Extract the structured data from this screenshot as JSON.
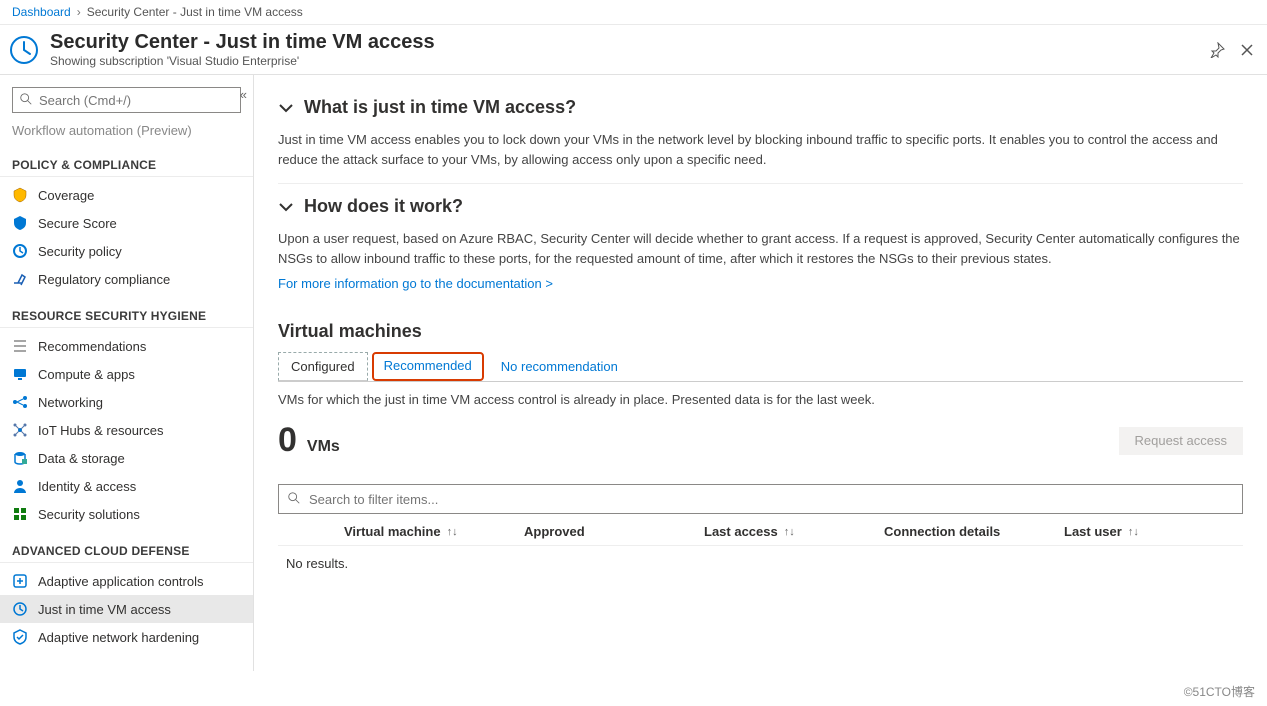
{
  "breadcrumb": {
    "root": "Dashboard",
    "current": "Security Center - Just in time VM access"
  },
  "header": {
    "title": "Security Center - Just in time VM access",
    "subtitle": "Showing subscription 'Visual Studio Enterprise'"
  },
  "search": {
    "placeholder": "Search (Cmd+/)"
  },
  "sidebar": {
    "cut_item": "Workflow automation (Preview)",
    "groups": [
      {
        "title": "POLICY & COMPLIANCE",
        "items": [
          {
            "label": "Coverage",
            "icon": "coverage"
          },
          {
            "label": "Secure Score",
            "icon": "shield"
          },
          {
            "label": "Security policy",
            "icon": "policy"
          },
          {
            "label": "Regulatory compliance",
            "icon": "gavel"
          }
        ]
      },
      {
        "title": "RESOURCE SECURITY HYGIENE",
        "items": [
          {
            "label": "Recommendations",
            "icon": "list"
          },
          {
            "label": "Compute & apps",
            "icon": "compute"
          },
          {
            "label": "Networking",
            "icon": "network"
          },
          {
            "label": "IoT Hubs & resources",
            "icon": "iot"
          },
          {
            "label": "Data & storage",
            "icon": "data"
          },
          {
            "label": "Identity & access",
            "icon": "identity"
          },
          {
            "label": "Security solutions",
            "icon": "grid"
          }
        ]
      },
      {
        "title": "ADVANCED CLOUD DEFENSE",
        "items": [
          {
            "label": "Adaptive application controls",
            "icon": "app-controls"
          },
          {
            "label": "Just in time VM access",
            "icon": "clock",
            "selected": true
          },
          {
            "label": "Adaptive network hardening",
            "icon": "net-hardening"
          }
        ]
      }
    ]
  },
  "content": {
    "exp1_title": "What is just in time VM access?",
    "exp1_body": "Just in time VM access enables you to lock down your VMs in the network level by blocking inbound traffic to specific ports. It enables you to control the access and reduce the attack surface to your VMs, by allowing access only upon a specific need.",
    "exp2_title": "How does it work?",
    "exp2_body": "Upon a user request, based on Azure RBAC, Security Center will decide whether to grant access. If a request is approved, Security Center automatically configures the NSGs to allow inbound traffic to these ports, for the requested amount of time, after which it restores the NSGs to their previous states.",
    "doc_link": "For more information go to the documentation >",
    "vm_section_title": "Virtual machines",
    "tabs": {
      "configured": "Configured",
      "recommended": "Recommended",
      "none": "No recommendation"
    },
    "tab_desc": "VMs for which the just in time VM access control is already in place. Presented data is for the last week.",
    "count_num": "0",
    "count_label": "VMs",
    "request_btn": "Request access",
    "filter_placeholder": "Search to filter items...",
    "columns": {
      "vm": "Virtual machine",
      "approved": "Approved",
      "last_access": "Last access",
      "conn": "Connection details",
      "last_user": "Last user"
    },
    "no_results": "No results."
  },
  "watermark": "©51CTO博客"
}
